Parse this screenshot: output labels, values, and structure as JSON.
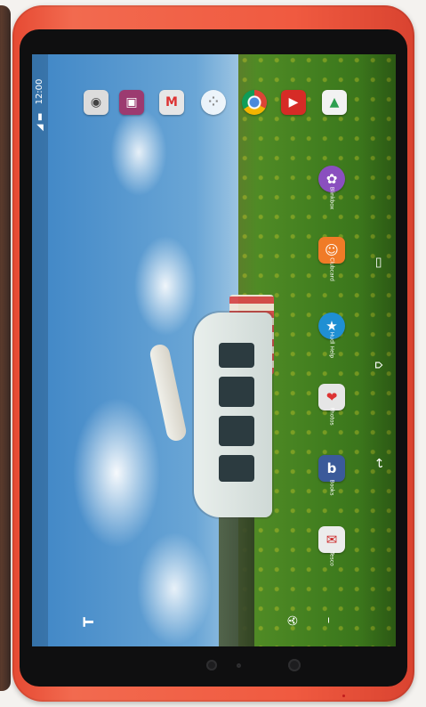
{
  "status_bar": {
    "time": "12:00",
    "wifi_icon": "wifi-icon",
    "battery_icon": "battery-icon"
  },
  "top_row_icons": [
    {
      "name": "camera",
      "icon": "camera-icon",
      "glyph": "◉",
      "color": "#d9d9d9"
    },
    {
      "name": "gallery",
      "icon": "photo-icon",
      "glyph": "▣",
      "color": "#a8407a"
    },
    {
      "name": "gmail",
      "icon": "gmail-icon",
      "glyph": "M",
      "color": "#d6d6d6"
    },
    {
      "name": "apps",
      "icon": "app-drawer-icon",
      "glyph": "⋮⋮",
      "color": "#e6e6e6"
    },
    {
      "name": "chrome",
      "icon": "chrome-icon",
      "glyph": "◎",
      "color": "#e8b51f"
    },
    {
      "name": "youtube",
      "icon": "youtube-icon",
      "glyph": "▶",
      "color": "#d62b26"
    },
    {
      "name": "play store",
      "icon": "play-store-icon",
      "glyph": "▲",
      "color": "#f2f2f2"
    }
  ],
  "home_apps": [
    {
      "icon": "flower-icon",
      "glyph": "✿",
      "color": "#8a4fbf",
      "label": "Blinkbox"
    },
    {
      "icon": "smile-icon",
      "glyph": "☺",
      "color": "#f07b27",
      "label": "Clubcard"
    },
    {
      "icon": "star-icon",
      "glyph": "★",
      "color": "#1f8fd3",
      "label": "Hudl Help"
    },
    {
      "icon": "photo-card-icon",
      "glyph": "❤",
      "color": "#d9d9d9",
      "label": "Photos"
    },
    {
      "icon": "book-icon",
      "glyph": "b",
      "color": "#3b5a9a",
      "label": "Books"
    },
    {
      "icon": "tesco-icon",
      "glyph": "✉",
      "color": "#e9e9e9",
      "label": "Tesco"
    }
  ],
  "nav_buttons": [
    {
      "icon": "recents-icon",
      "glyph": "▭"
    },
    {
      "icon": "home-icon",
      "glyph": "⌂"
    },
    {
      "icon": "back-icon",
      "glyph": "↩"
    }
  ],
  "left_bottom_icons": {
    "tesco_logo": "T",
    "mic_icon": "🎤"
  }
}
